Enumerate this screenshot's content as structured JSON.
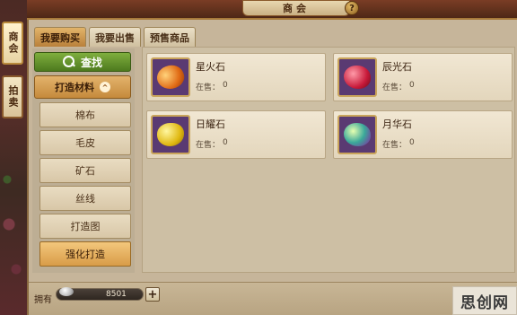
{
  "window": {
    "title": "商会",
    "help_label": "?",
    "close_label": "✕"
  },
  "side_tabs": [
    {
      "label": "商会",
      "active": true
    },
    {
      "label": "拍卖",
      "active": false
    }
  ],
  "tabs": [
    {
      "label": "我要购买",
      "active": true
    },
    {
      "label": "我要出售",
      "active": false
    },
    {
      "label": "预售商品",
      "active": false
    }
  ],
  "sidebar": {
    "search_label": "查找",
    "search_icon": "magnifier-icon",
    "category_label": "打造材料",
    "category_chevron": "^",
    "items": [
      {
        "label": "棉布",
        "selected": false
      },
      {
        "label": "毛皮",
        "selected": false
      },
      {
        "label": "矿石",
        "selected": false
      },
      {
        "label": "丝线",
        "selected": false
      },
      {
        "label": "打造图",
        "selected": false
      },
      {
        "label": "强化打造",
        "selected": true
      }
    ]
  },
  "items": [
    {
      "name": "星火石",
      "stock_label": "在售：",
      "stock": "0",
      "gem_color": "#e06a14",
      "icon": "orange-gem-icon"
    },
    {
      "name": "辰光石",
      "stock_label": "在售：",
      "stock": "0",
      "gem_color": "#c81a3a",
      "icon": "red-gem-icon"
    },
    {
      "name": "日耀石",
      "stock_label": "在售：",
      "stock": "0",
      "gem_color": "#e0b810",
      "icon": "yellow-gem-icon"
    },
    {
      "name": "月华石",
      "stock_label": "在售：",
      "stock": "0",
      "gem_color": "#3aa89a",
      "icon": "cyan-gem-icon"
    }
  ],
  "footer": {
    "own_label": "拥有",
    "currency_icon": "silver-ingot-icon",
    "money": "8501",
    "plus_label": "+"
  },
  "watermark": "思创网"
}
